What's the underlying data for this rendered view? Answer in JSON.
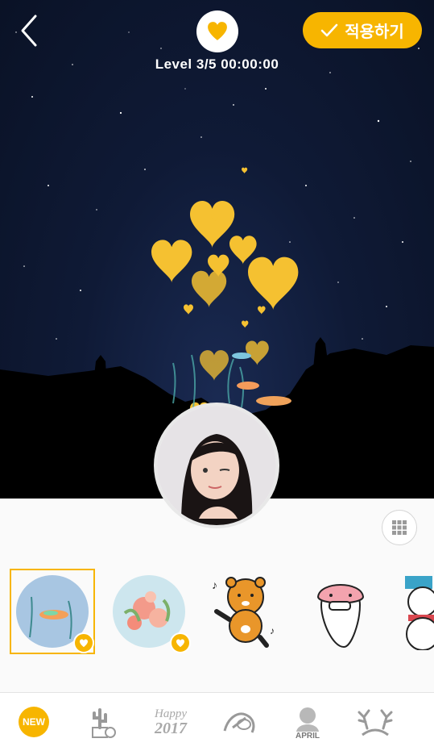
{
  "header": {
    "level_text": "Level 3/5 00:00:00",
    "apply_label": "적용하기",
    "accent": "#f7b500"
  },
  "icons": {
    "back": "chevron-left-icon",
    "effect": "heart-icon",
    "apply": "check-icon",
    "grid": "grid-icon"
  },
  "stickers": [
    {
      "name": "fish-sticker",
      "selected": true,
      "has_heart_badge": true
    },
    {
      "name": "flower-sticker",
      "selected": false,
      "has_heart_badge": true
    },
    {
      "name": "bear-character-sticker",
      "selected": false,
      "has_heart_badge": false
    },
    {
      "name": "peach-character-sticker",
      "selected": false,
      "has_heart_badge": false
    },
    {
      "name": "snowman-sticker",
      "selected": false,
      "has_heart_badge": false
    }
  ],
  "tabs": {
    "new_label": "NEW",
    "happy_line1": "Happy",
    "happy_line2": "2017",
    "april_label": "APRIL"
  }
}
